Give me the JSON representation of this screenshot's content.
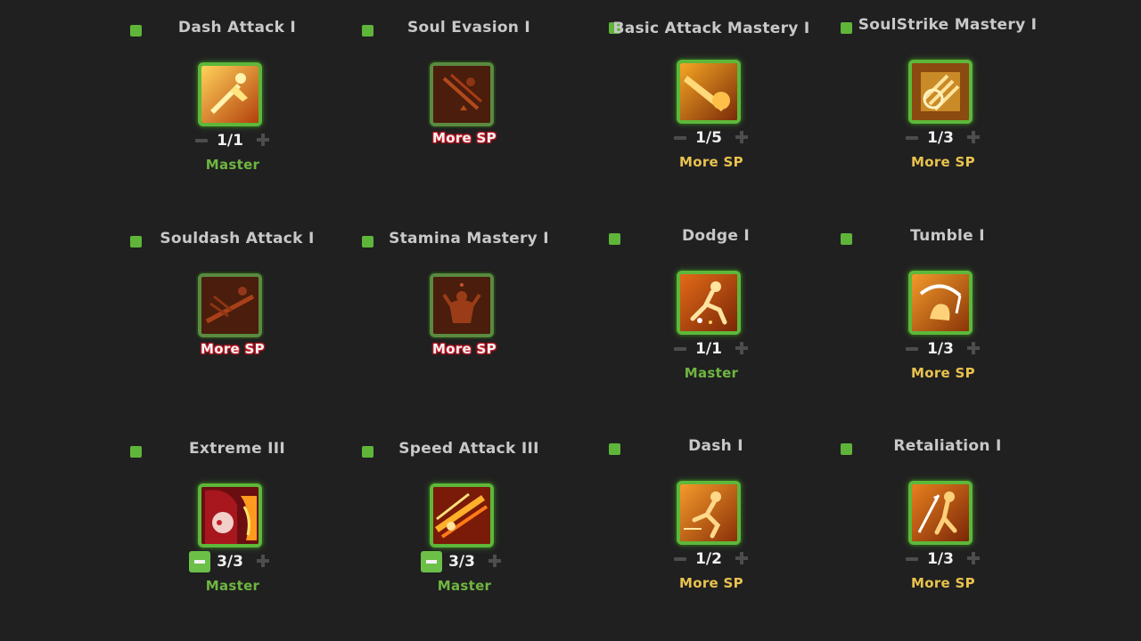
{
  "colors": {
    "background": "#202020",
    "accent_green": "#5fb53a",
    "master_text": "#6fb541",
    "more_sp_yellow": "#e9c24e",
    "more_sp_red": "#c81e2a"
  },
  "skills": [
    {
      "name": "Dash Attack I",
      "level": "1/1",
      "status": "Master",
      "status_kind": "master",
      "icon": "dash-attack-icon",
      "locked": false,
      "minus_active": false
    },
    {
      "name": "Soul Evasion I",
      "level": "",
      "status": "More SP",
      "status_kind": "red",
      "icon": "soul-evasion-icon",
      "locked": true,
      "minus_active": false
    },
    {
      "name": "Basic Attack Mastery I",
      "level": "1/5",
      "status": "More SP",
      "status_kind": "yellow",
      "icon": "basic-attack-mastery-icon",
      "locked": false,
      "minus_active": false
    },
    {
      "name": "SoulStrike Mastery I",
      "level": "1/3",
      "status": "More SP",
      "status_kind": "yellow",
      "icon": "soulstrike-mastery-icon",
      "locked": false,
      "minus_active": false
    },
    {
      "name": "Souldash Attack I",
      "level": "",
      "status": "More SP",
      "status_kind": "red",
      "icon": "souldash-attack-icon",
      "locked": true,
      "minus_active": false
    },
    {
      "name": "Stamina Mastery I",
      "level": "",
      "status": "More SP",
      "status_kind": "red",
      "icon": "stamina-mastery-icon",
      "locked": true,
      "minus_active": false
    },
    {
      "name": "Dodge I",
      "level": "1/1",
      "status": "Master",
      "status_kind": "master",
      "icon": "dodge-icon",
      "locked": false,
      "minus_active": false
    },
    {
      "name": "Tumble I",
      "level": "1/3",
      "status": "More SP",
      "status_kind": "yellow",
      "icon": "tumble-icon",
      "locked": false,
      "minus_active": false
    },
    {
      "name": "Extreme III",
      "level": "3/3",
      "status": "Master",
      "status_kind": "master",
      "icon": "extreme-portrait-icon",
      "locked": false,
      "minus_active": true
    },
    {
      "name": "Speed Attack III",
      "level": "3/3",
      "status": "Master",
      "status_kind": "master",
      "icon": "speed-attack-icon",
      "locked": false,
      "minus_active": true
    },
    {
      "name": "Dash I",
      "level": "1/2",
      "status": "More SP",
      "status_kind": "yellow",
      "icon": "dash-icon",
      "locked": false,
      "minus_active": false
    },
    {
      "name": "Retaliation I",
      "level": "1/3",
      "status": "More SP",
      "status_kind": "yellow",
      "icon": "retaliation-icon",
      "locked": false,
      "minus_active": false
    }
  ]
}
